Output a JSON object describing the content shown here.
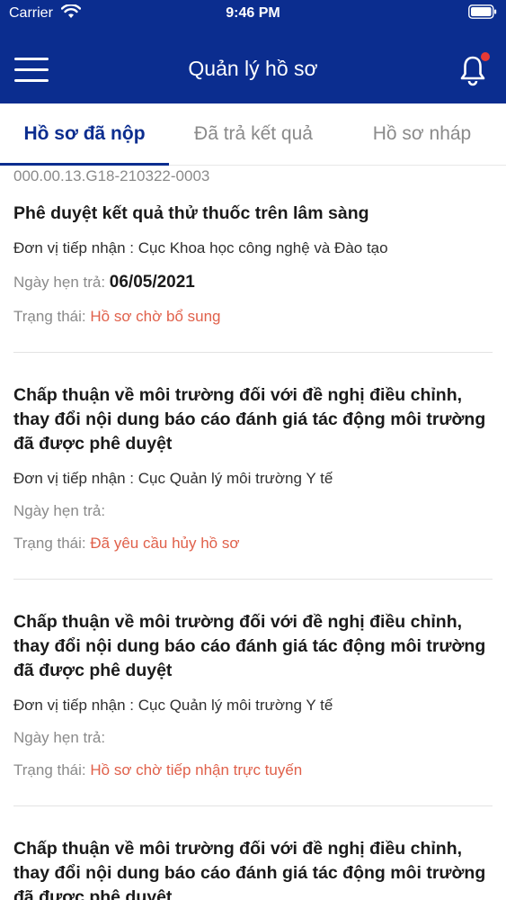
{
  "status_bar": {
    "carrier": "Carrier",
    "time": "9:46 PM"
  },
  "header": {
    "title": "Quản lý hồ sơ"
  },
  "tabs": [
    {
      "label": "Hồ sơ đã nộp"
    },
    {
      "label": "Đã trả kết quả"
    },
    {
      "label": "Hồ sơ nháp"
    }
  ],
  "labels": {
    "receiver": "Đơn vị tiếp nhận : ",
    "due": "Ngày hẹn trả: ",
    "status": "Trạng thái: "
  },
  "records": [
    {
      "code": "000.00.13.G18-210322-0003",
      "title": "Phê duyệt kết quả thử thuốc trên lâm sàng",
      "receiver": "Cục Khoa học công nghệ và Đào tạo",
      "due": "06/05/2021",
      "status": "Hồ sơ chờ bổ sung"
    },
    {
      "title": "Chấp thuận về môi trường đối với đề nghị điều chỉnh, thay đổi nội dung báo cáo đánh giá tác động môi trường đã được phê duyệt",
      "receiver": "Cục Quản lý môi trường Y tế",
      "due": "",
      "status": "Đã yêu cầu hủy hồ sơ"
    },
    {
      "title": "Chấp thuận về môi trường đối với đề nghị điều chỉnh, thay đổi nội dung báo cáo đánh giá tác động môi trường đã được phê duyệt",
      "receiver": "Cục Quản lý môi trường Y tế",
      "due": "",
      "status": "Hồ sơ chờ tiếp nhận trực tuyến"
    },
    {
      "title": "Chấp thuận về môi trường đối với đề nghị điều chỉnh, thay đổi nội dung báo cáo đánh giá tác động môi trường đã được phê duyệt"
    }
  ],
  "colors": {
    "brand": "#0b2d8f",
    "status": "#e0604a",
    "badge": "#e53935"
  },
  "icons": {
    "menu": "hamburger-icon",
    "notifications": "bell-icon",
    "wifi": "wifi-icon",
    "battery": "battery-icon"
  }
}
